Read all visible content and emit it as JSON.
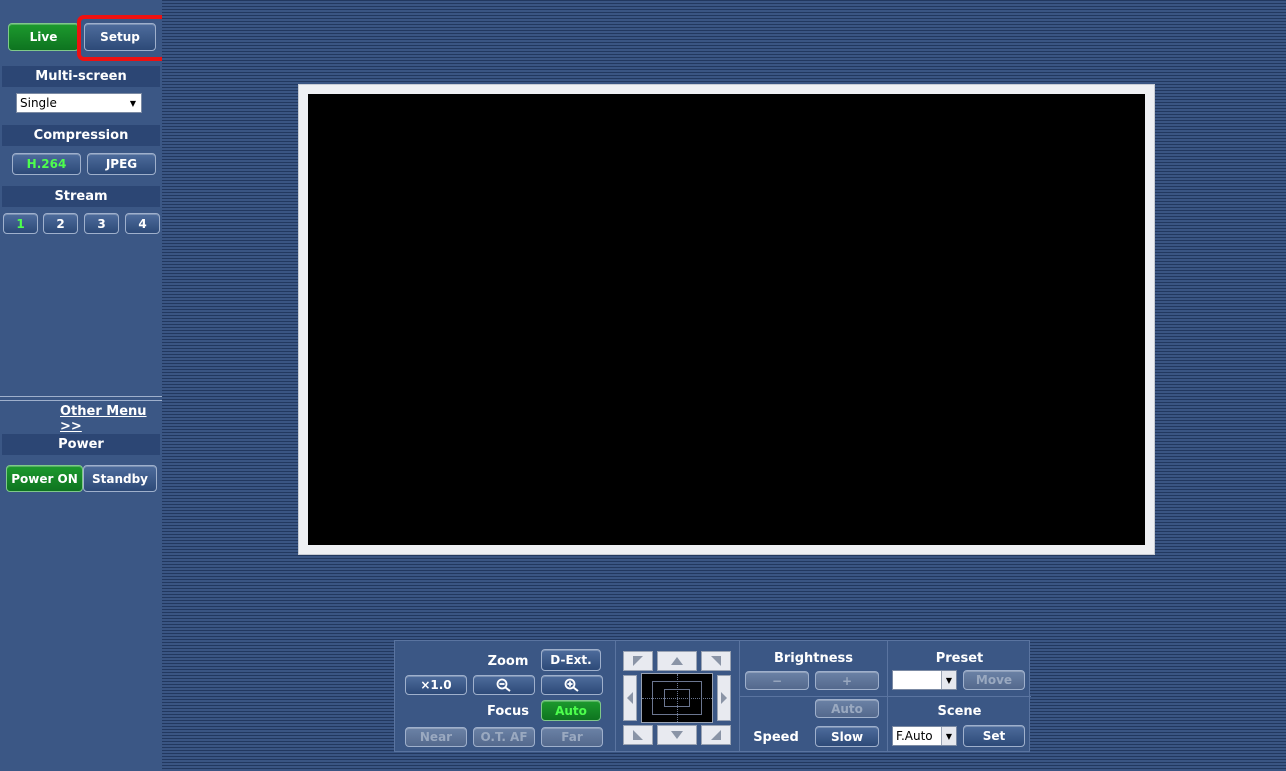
{
  "sidebar": {
    "tabs": {
      "live": "Live",
      "setup": "Setup"
    },
    "multiscreen": {
      "header": "Multi-screen",
      "value": "Single"
    },
    "compression": {
      "header": "Compression",
      "h264": "H.264",
      "jpeg": "JPEG"
    },
    "stream": {
      "header": "Stream",
      "items": [
        "1",
        "2",
        "3",
        "4"
      ]
    },
    "other_menu": "Other Menu >>",
    "power": {
      "header": "Power",
      "on": "Power ON",
      "standby": "Standby"
    }
  },
  "controls": {
    "zoom": {
      "label": "Zoom",
      "dext": "D-Ext.",
      "x10": "×1.0"
    },
    "focus": {
      "label": "Focus",
      "auto": "Auto",
      "near": "Near",
      "otaf": "O.T. AF",
      "far": "Far"
    },
    "brightness": {
      "label": "Brightness",
      "minus": "−",
      "plus": "+",
      "auto": "Auto"
    },
    "speed": {
      "label": "Speed",
      "value": "Slow"
    },
    "preset": {
      "label": "Preset",
      "value": "",
      "move": "Move"
    },
    "scene": {
      "label": "Scene",
      "value": "F.Auto",
      "set": "Set"
    }
  },
  "colors": {
    "accent_green": "#1d9a2e",
    "active_text": "#4dff4d",
    "highlight": "#ee1111"
  }
}
